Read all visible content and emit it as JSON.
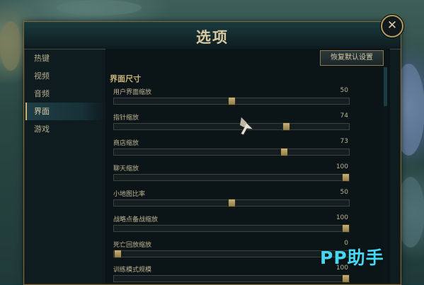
{
  "window": {
    "title": "选项"
  },
  "sidebar": {
    "items": [
      {
        "label": "热键"
      },
      {
        "label": "视频"
      },
      {
        "label": "音频"
      },
      {
        "label": "界面",
        "active": true
      },
      {
        "label": "游戏"
      }
    ]
  },
  "content": {
    "reset_label": "恢复默认设置",
    "section_title": "界面尺寸",
    "settings": [
      {
        "label": "用户界面缩放",
        "value": "50",
        "level": 0.5
      },
      {
        "label": "指针缩放",
        "value": "74",
        "level": 0.74
      },
      {
        "label": "商店缩放",
        "value": "73",
        "level": 0.73
      },
      {
        "label": "聊天缩放",
        "value": "100",
        "level": 1.0
      },
      {
        "label": "小地图比率",
        "value": "50",
        "level": 0.5
      },
      {
        "label": "战略点备战缩放",
        "value": "100",
        "level": 1.0
      },
      {
        "label": "死亡回放缩放",
        "value": "0",
        "level": 0.0
      },
      {
        "label": "训练模式规模",
        "value": "100",
        "level": 1.0
      }
    ]
  },
  "icons": {
    "close": "close-icon",
    "cursor": "pointer-cursor-icon"
  },
  "watermark": {
    "text": "PP助手"
  },
  "colors": {
    "accent": "#c8b27a",
    "watermark": "#45d8f2"
  }
}
